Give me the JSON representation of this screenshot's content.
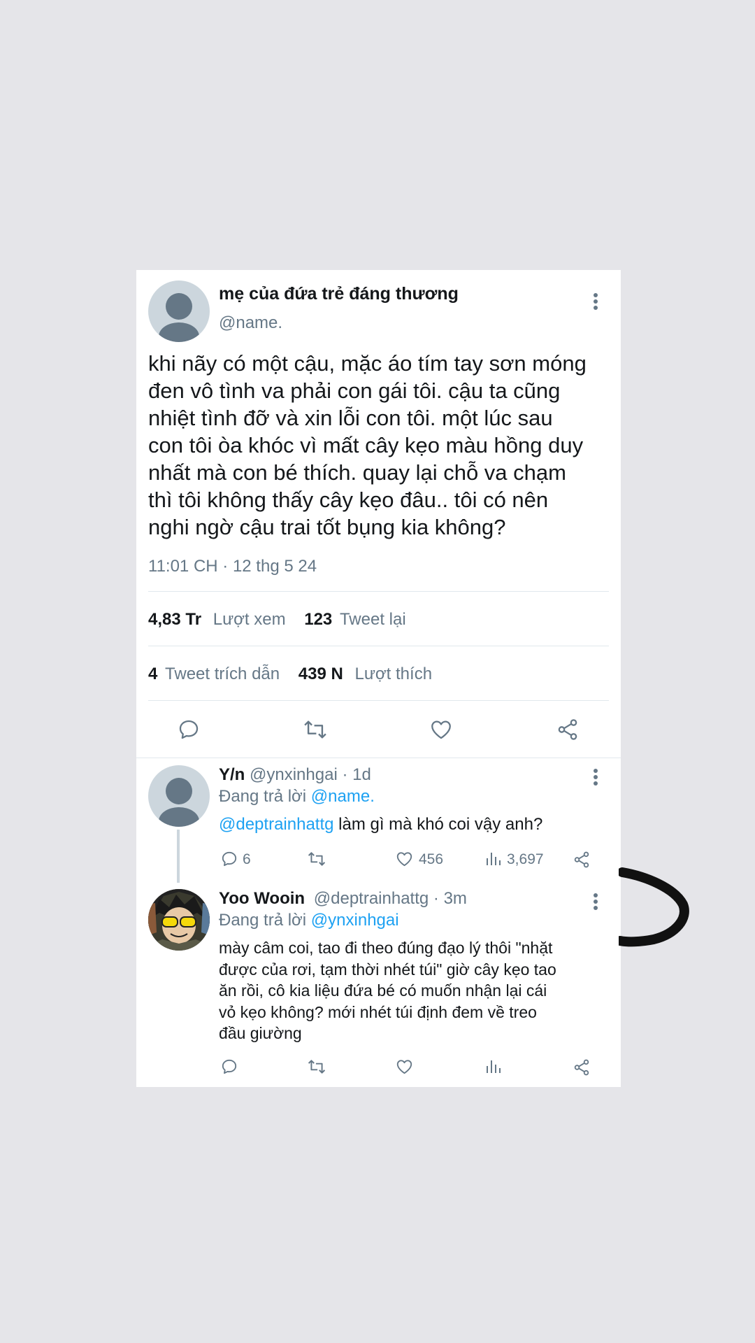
{
  "main_tweet": {
    "display_name": "mẹ của đứa trẻ đáng thương",
    "handle": "@name.",
    "lines": [
      "khi nãy có một cậu, mặc áo tím tay sơn móng",
      "đen vô tình va phải con gái tôi. cậu ta cũng",
      "nhiệt tình đỡ và xin lỗi con tôi. một lúc sau",
      "con tôi òa khóc vì mất cây kẹo màu hồng duy",
      "nhất mà con bé thích. quay lại chỗ va chạm",
      "thì tôi không thấy cây kẹo đâu.. tôi có nên",
      "nghi ngờ cậu trai tốt bụng kia không?"
    ],
    "timestamp": "11:01 CH · 12 thg 5 24",
    "stats": {
      "views_count": "4,83 Tr",
      "views_label": "Lượt xem",
      "retweets_count": "123",
      "retweets_label": "Tweet lại",
      "quotes_count": "4",
      "quotes_label": "Tweet trích dẫn",
      "likes_count": "439 N",
      "likes_label": "Lượt thích"
    }
  },
  "reply1": {
    "display_name": "Y/n",
    "handle_time": "@ynxinhgai · 1d",
    "replying_prefix": "Đang trả lời",
    "replying_to": "@name.",
    "mention": "@deptrainhattg",
    "text": "làm gì mà khó coi vậy anh?",
    "replies": "6",
    "likes": "456",
    "views": "3,697"
  },
  "reply2": {
    "display_name": "Yoo Wooin",
    "handle_time": "@deptrainhattg · 3m",
    "replying_prefix": "Đang trả lời",
    "replying_to": "@ynxinhgai",
    "lines": [
      "mày câm coi, tao đi theo đúng đạo lý thôi \"nhặt",
      "được của rơi, tạm thời nhét túi\" giờ cây kẹo tao",
      "ăn rồi, cô kia liệu đứa bé có muốn nhận lại cái",
      "vỏ kẹo không? mới nhét túi định đem về treo",
      "đầu giường"
    ]
  },
  "icons": {
    "reply": "comment-icon",
    "retweet": "retweet-icon",
    "like": "heart-icon",
    "share": "share-icon",
    "views": "analytics-icon",
    "more": "more-vertical-icon"
  },
  "colors": {
    "accent": "#1da1f2",
    "secondary_text": "#657786",
    "primary_text": "#14171a",
    "background": "#e5e5e9"
  }
}
